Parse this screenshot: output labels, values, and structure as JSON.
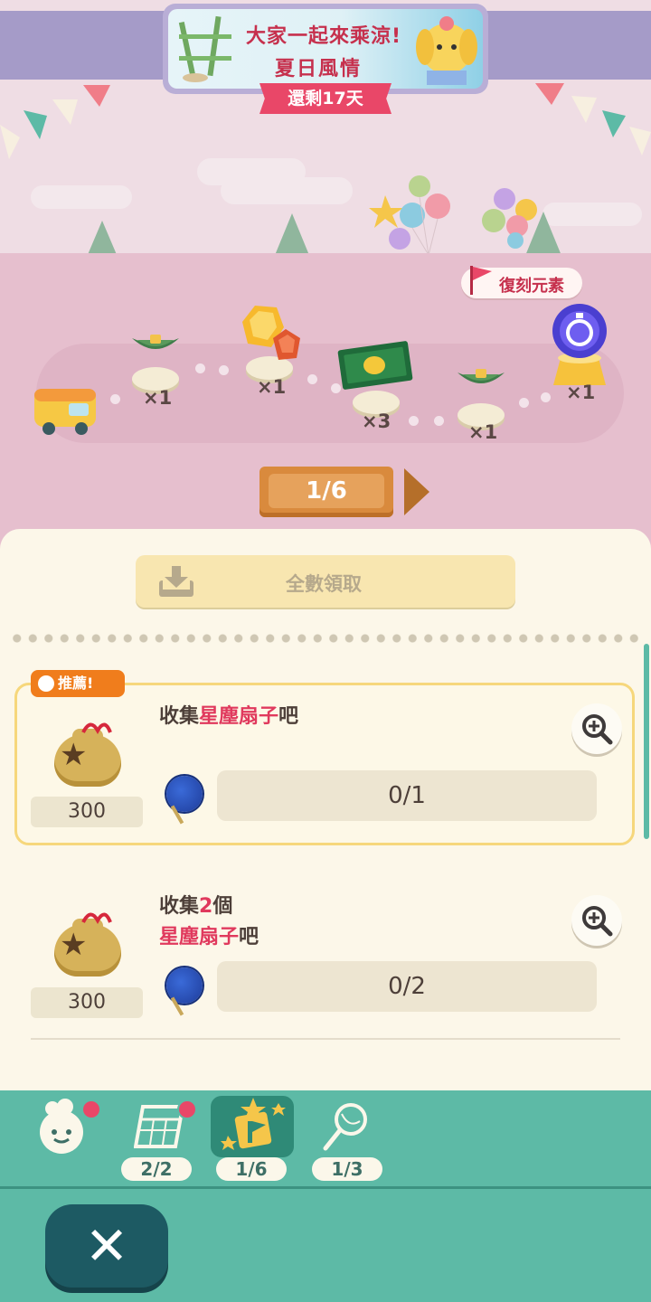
{
  "event": {
    "title_line1": "大家一起來乘涼!",
    "title_line2": "夏日風情",
    "days_left": "還剩17天"
  },
  "track": {
    "replica_tag": "復刻元素",
    "rewards": [
      {
        "item": "leaf-boat",
        "qty": "×1"
      },
      {
        "item": "amber-gems",
        "qty": "×1"
      },
      {
        "item": "leaf-ticket",
        "qty": "×3"
      },
      {
        "item": "leaf-boat",
        "qty": "×1"
      },
      {
        "item": "blue-orb-clock",
        "qty": "×1"
      }
    ]
  },
  "pager": {
    "label": "1/6"
  },
  "panel": {
    "claim_all": "全數領取",
    "recommend_badge": "推薦!",
    "missions": [
      {
        "prefix": "收集",
        "highlight": "星塵扇子",
        "suffix": "吧",
        "reward": "300",
        "progress": "0/1"
      },
      {
        "line1_prefix": "收集",
        "line1_highlight": "2",
        "line1_suffix": "個",
        "line2_highlight": "星塵扇子",
        "line2_suffix": "吧",
        "reward": "300",
        "progress": "0/2"
      }
    ]
  },
  "tabs": [
    {
      "icon": "villager-icon",
      "count": null,
      "badge": true
    },
    {
      "icon": "calendar-icon",
      "count": "2/2",
      "badge": true
    },
    {
      "icon": "event-flag-icon",
      "count": "1/6",
      "badge": false,
      "active": true
    },
    {
      "icon": "net-icon",
      "count": "1/3",
      "badge": false
    }
  ],
  "colors": {
    "accent_pink": "#e94768",
    "teal": "#5dbaa6",
    "highlight": "#e0395d"
  }
}
